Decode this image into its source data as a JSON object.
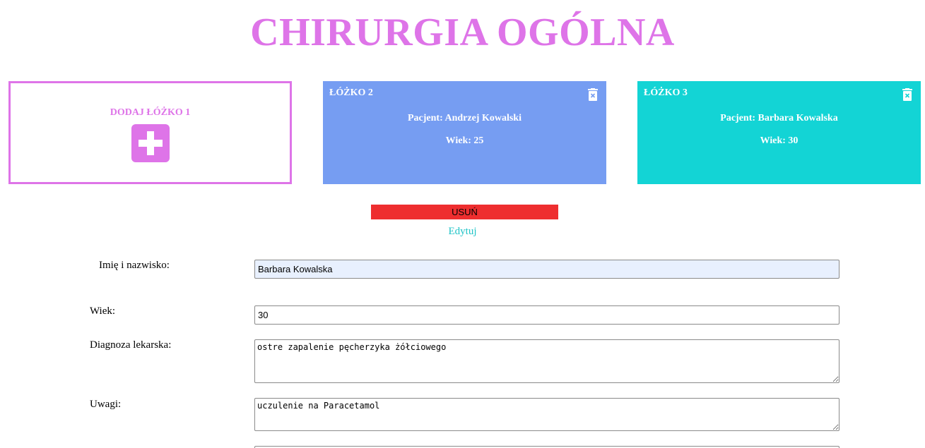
{
  "header": {
    "title": "CHIRURGIA OGÓLNA"
  },
  "colors": {
    "accent": "#de74e8",
    "bed2": "#769df2",
    "bed3": "#13d4d5",
    "delete": "#ee2e2f",
    "link": "#20c4c7"
  },
  "beds": {
    "add": {
      "label": "DODAJ ŁÓŻKO 1",
      "icon": "plus-icon"
    },
    "bed2": {
      "name": "ŁÓŻKO 2",
      "patient": "Pacjent: Andrzej Kowalski",
      "age": "Wiek: 25",
      "icon": "trash-icon"
    },
    "bed3": {
      "name": "ŁÓŻKO 3",
      "patient": "Pacjent: Barbara Kowalska",
      "age": "Wiek: 30",
      "icon": "trash-icon"
    }
  },
  "actions": {
    "delete_label": "USUŃ",
    "edit_label": "Edytuj"
  },
  "form": {
    "name_label": "Imię i nazwisko:",
    "name_value": "Barbara Kowalska",
    "age_label": "Wiek:",
    "age_value": "30",
    "diagnosis_label": "Diagnoza lekarska:",
    "diagnosis_value": "ostre zapalenie pęcherzyka żółciowego",
    "notes_label": "Uwagi:",
    "notes_value": "uczulenie na Paracetamol"
  }
}
